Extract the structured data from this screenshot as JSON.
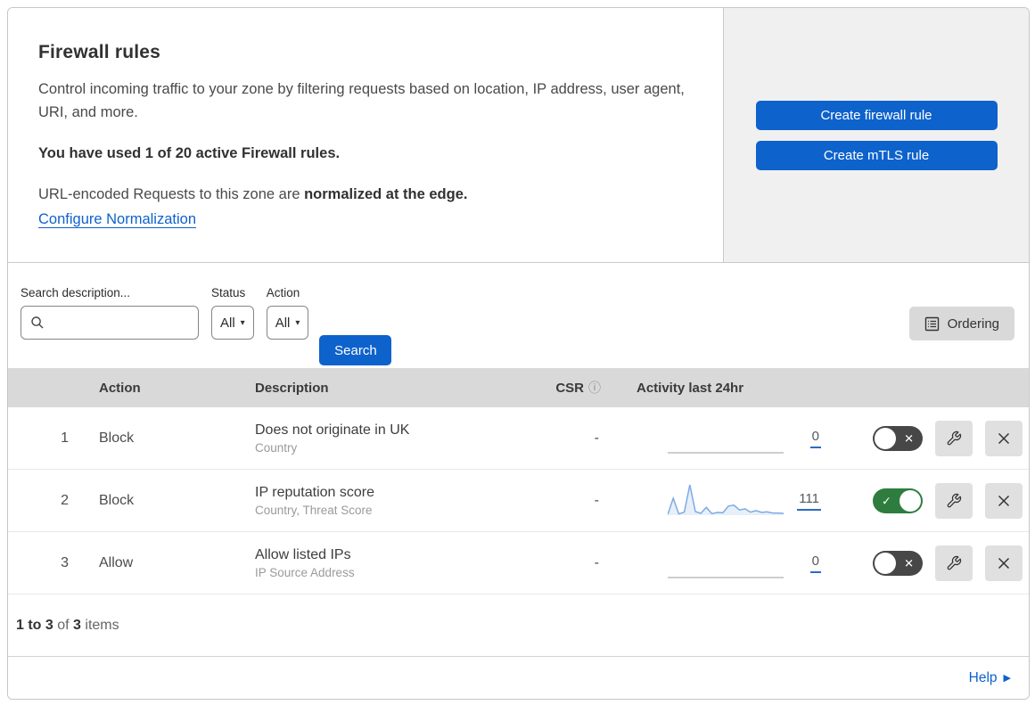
{
  "header": {
    "title": "Firewall rules",
    "description": "Control incoming traffic to your zone by filtering requests based on location, IP address, user agent, URI, and more.",
    "usage_notice": "You have used 1 of 20 active Firewall rules.",
    "normalization_text": "URL-encoded Requests to this zone are ",
    "normalization_bold": "normalized at the edge.",
    "normalization_link": "Configure Normalization",
    "buttons": {
      "create_firewall": "Create firewall rule",
      "create_mtls": "Create mTLS rule"
    }
  },
  "filters": {
    "search_label": "Search description...",
    "search_value": "",
    "status_label": "Status",
    "status_value": "All",
    "action_label": "Action",
    "action_value": "All",
    "search_button": "Search",
    "ordering_button": "Ordering"
  },
  "table": {
    "columns": {
      "action": "Action",
      "description": "Description",
      "csr": "CSR",
      "activity": "Activity last 24hr"
    },
    "rows": [
      {
        "priority": "1",
        "action": "Block",
        "description": "Does not originate in UK",
        "criteria": "Country",
        "csr": "-",
        "activity_count": "0",
        "enabled": false,
        "sparkline": [
          0,
          0,
          0,
          0,
          0,
          0,
          0,
          0,
          0,
          0,
          0,
          0,
          0,
          0,
          0,
          0,
          0,
          0,
          0,
          0,
          0,
          0
        ]
      },
      {
        "priority": "2",
        "action": "Block",
        "description": "IP reputation score",
        "criteria": "Country, Threat Score",
        "csr": "-",
        "activity_count": "111",
        "enabled": true,
        "sparkline": [
          2,
          56,
          4,
          10,
          100,
          12,
          6,
          26,
          5,
          9,
          8,
          30,
          33,
          17,
          21,
          10,
          15,
          9,
          11,
          7,
          7,
          6
        ]
      },
      {
        "priority": "3",
        "action": "Allow",
        "description": "Allow listed IPs",
        "criteria": "IP Source Address",
        "csr": "-",
        "activity_count": "0",
        "enabled": false,
        "sparkline": [
          0,
          0,
          0,
          0,
          0,
          0,
          0,
          0,
          0,
          0,
          0,
          0,
          0,
          0,
          0,
          0,
          0,
          0,
          0,
          0,
          0,
          0
        ]
      }
    ]
  },
  "footer": {
    "range": "1 to 3",
    "of": " of ",
    "total": "3",
    "items": " items"
  },
  "help": {
    "label": "Help",
    "arrow": "▶"
  },
  "icons": {
    "toggle_on_glyph": "✓",
    "toggle_off_glyph": "✕",
    "info": "ⓘ",
    "caret": "▾"
  },
  "colors": {
    "accent_blue": "#0e62cc",
    "toggle_on_green": "#2e7d3e",
    "toggle_off_gray": "#474747",
    "sparkline_blue": "#7fa9e4",
    "header_gray": "#d9d9d9"
  }
}
